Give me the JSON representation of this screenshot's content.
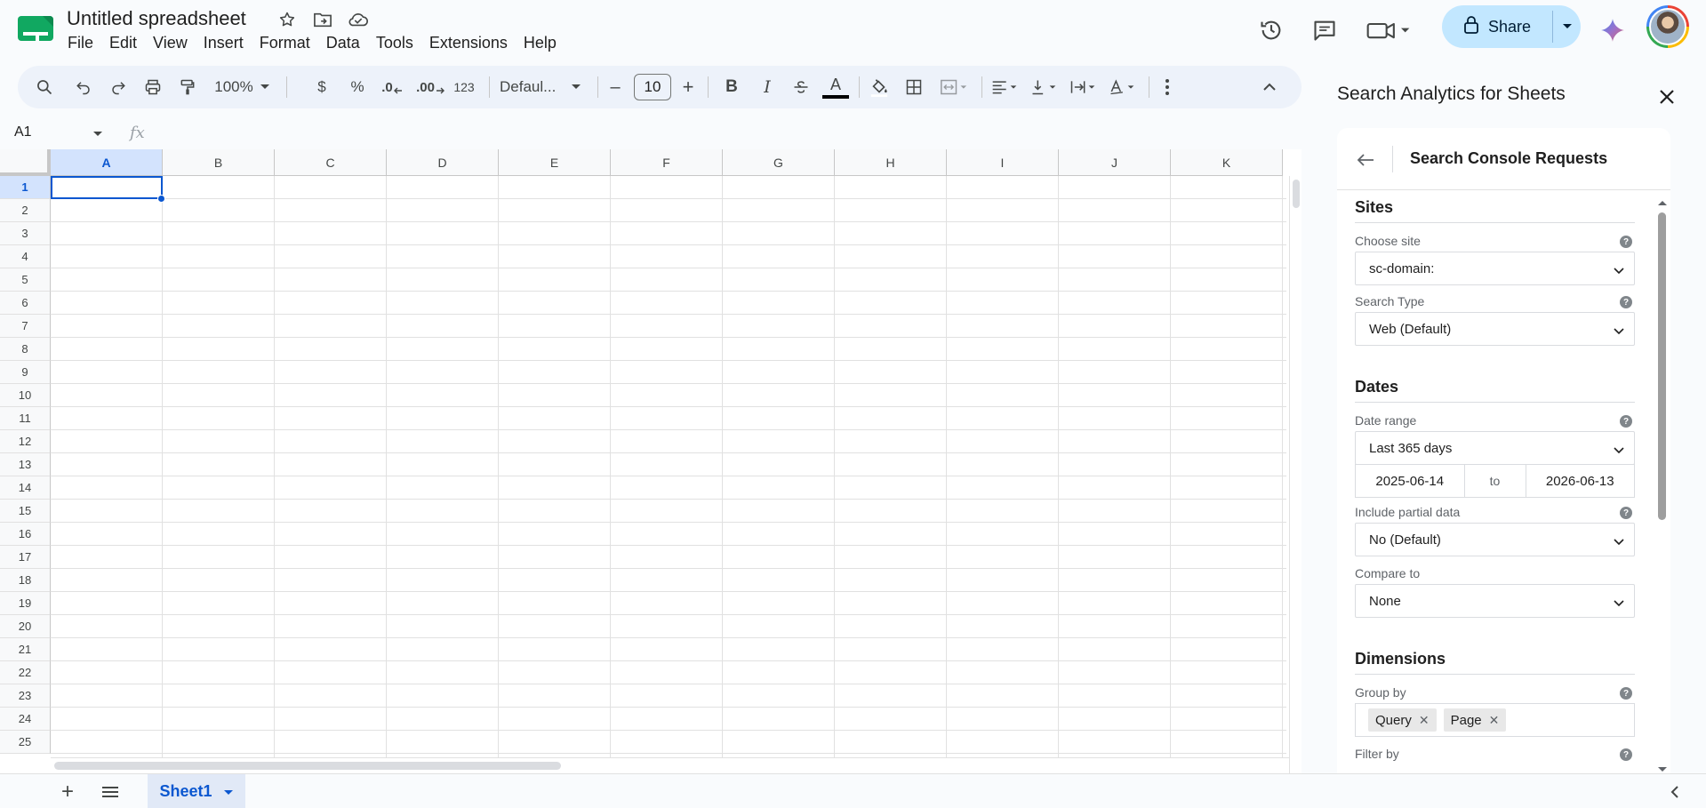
{
  "doc": {
    "title": "Untitled spreadsheet"
  },
  "menu": [
    "File",
    "Edit",
    "View",
    "Insert",
    "Format",
    "Data",
    "Tools",
    "Extensions",
    "Help"
  ],
  "share": {
    "label": "Share"
  },
  "toolbar": {
    "zoom": "100%",
    "currency": "$",
    "percent": "%",
    "dec_less": ".0",
    "dec_more": ".00",
    "number_format": "123",
    "font": "Defaul...",
    "font_size": "10",
    "minus": "–",
    "plus": "+",
    "bold": "B",
    "italic": "I",
    "text_color": "A"
  },
  "formula_bar": {
    "name_box": "A1",
    "fx": "fx"
  },
  "grid": {
    "columns": [
      "A",
      "B",
      "C",
      "D",
      "E",
      "F",
      "G",
      "H",
      "I",
      "J",
      "K"
    ],
    "rows": [
      "1",
      "2",
      "3",
      "4",
      "5",
      "6",
      "7",
      "8",
      "9",
      "10",
      "11",
      "12",
      "13",
      "14",
      "15",
      "16",
      "17",
      "18",
      "19",
      "20",
      "21",
      "22",
      "23",
      "24",
      "25"
    ],
    "selected_column": "A",
    "selected_row": "1"
  },
  "sheets": {
    "add": "+",
    "active": "Sheet1"
  },
  "panel": {
    "title": "Search Analytics for Sheets",
    "card_title": "Search Console Requests",
    "sites": {
      "title": "Sites",
      "choose_site_label": "Choose site",
      "choose_site_value": "sc-domain:",
      "search_type_label": "Search Type",
      "search_type_value": "Web (Default)"
    },
    "dates": {
      "title": "Dates",
      "date_range_label": "Date range",
      "date_range_value": "Last 365 days",
      "start": "2025-06-14",
      "to": "to",
      "end": "2026-06-13",
      "partial_label": "Include partial data",
      "partial_value": "No (Default)",
      "compare_label": "Compare to",
      "compare_value": "None"
    },
    "dimensions": {
      "title": "Dimensions",
      "group_by_label": "Group by",
      "chips": [
        "Query",
        "Page"
      ],
      "filter_by_label": "Filter by"
    },
    "help_glyph": "?"
  },
  "colors": {
    "accent": "#0b57d0",
    "share_bg": "#c2e7ff",
    "toolbar_bg": "#edf2fa",
    "header_selected": "#d3e3fd"
  }
}
